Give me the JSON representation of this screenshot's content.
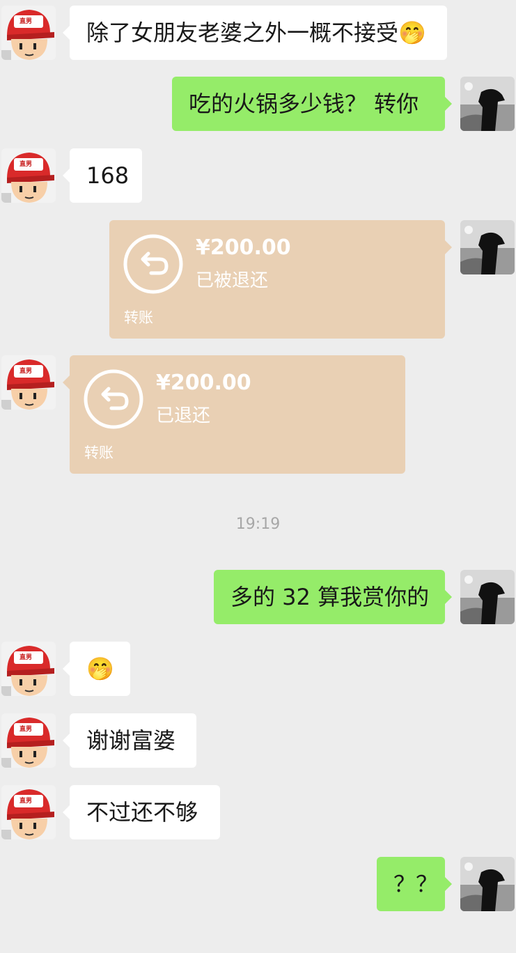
{
  "colors": {
    "background": "#ededed",
    "sent_bubble": "#95ec69",
    "received_bubble": "#ffffff",
    "transfer_card": "#e9d0b4"
  },
  "avatars": {
    "left_badge_text": "直男",
    "left_icon": "cartoon-boy-red-cap",
    "right_icon": "woman-silhouette-photo"
  },
  "messages": [
    {
      "side": "left",
      "text": "除了女朋友老婆之外一概不接受",
      "emoji": "🤭"
    },
    {
      "side": "right",
      "text": "吃的火锅多少钱？ 转你"
    },
    {
      "side": "left",
      "text": "168"
    },
    {
      "side": "right",
      "type": "transfer",
      "amount": "¥200.00",
      "status": "已被退还",
      "label": "转账"
    },
    {
      "side": "left",
      "type": "transfer",
      "amount": "¥200.00",
      "status": "已退还",
      "label": "转账"
    },
    {
      "type": "time",
      "text": "19:19"
    },
    {
      "side": "right",
      "text": "多的 32 算我赏你的"
    },
    {
      "side": "left",
      "emoji": "🤭"
    },
    {
      "side": "left",
      "text": "谢谢富婆"
    },
    {
      "side": "left",
      "text": "不过还不够"
    },
    {
      "side": "right",
      "text": "？？"
    }
  ]
}
